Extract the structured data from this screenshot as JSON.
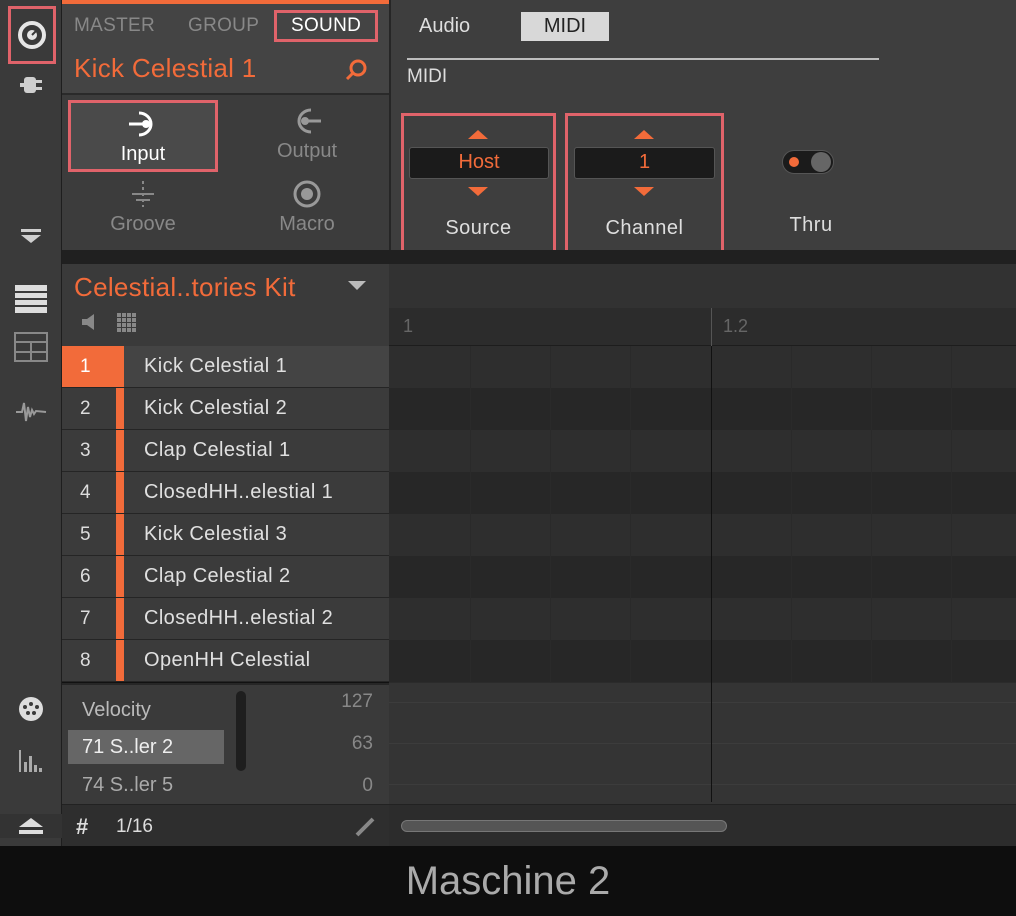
{
  "nav": {
    "tabs": [
      "MASTER",
      "GROUP",
      "SOUND"
    ],
    "sound_name": "Kick Celestial 1",
    "sections": [
      "Input",
      "Output",
      "Groove",
      "Macro"
    ]
  },
  "midi_panel": {
    "tabs": [
      "Audio",
      "MIDI"
    ],
    "section_title": "MIDI",
    "source_label": "Source",
    "source_value": "Host",
    "channel_label": "Channel",
    "channel_value": "1",
    "thru_label": "Thru"
  },
  "kit": {
    "name": "Celestial..tories Kit"
  },
  "ruler": {
    "markers": [
      "1",
      "1.2"
    ]
  },
  "sounds": [
    {
      "num": "1",
      "name": "Kick Celestial 1"
    },
    {
      "num": "2",
      "name": "Kick Celestial 2"
    },
    {
      "num": "3",
      "name": "Clap Celestial 1"
    },
    {
      "num": "4",
      "name": "ClosedHH..elestial 1"
    },
    {
      "num": "5",
      "name": "Kick Celestial 3"
    },
    {
      "num": "6",
      "name": "Clap Celestial 2"
    },
    {
      "num": "7",
      "name": "ClosedHH..elestial 2"
    },
    {
      "num": "8",
      "name": "OpenHH Celestial"
    }
  ],
  "velocity": {
    "items": [
      "Velocity",
      "71 S..ler 2",
      "74 S..ler 5"
    ],
    "scale": [
      "127",
      "63",
      "0"
    ]
  },
  "footer": {
    "grid_value": "1/16"
  },
  "caption": "Maschine 2",
  "colors": {
    "accent": "#f26b3a",
    "highlight": "#e0636a"
  }
}
